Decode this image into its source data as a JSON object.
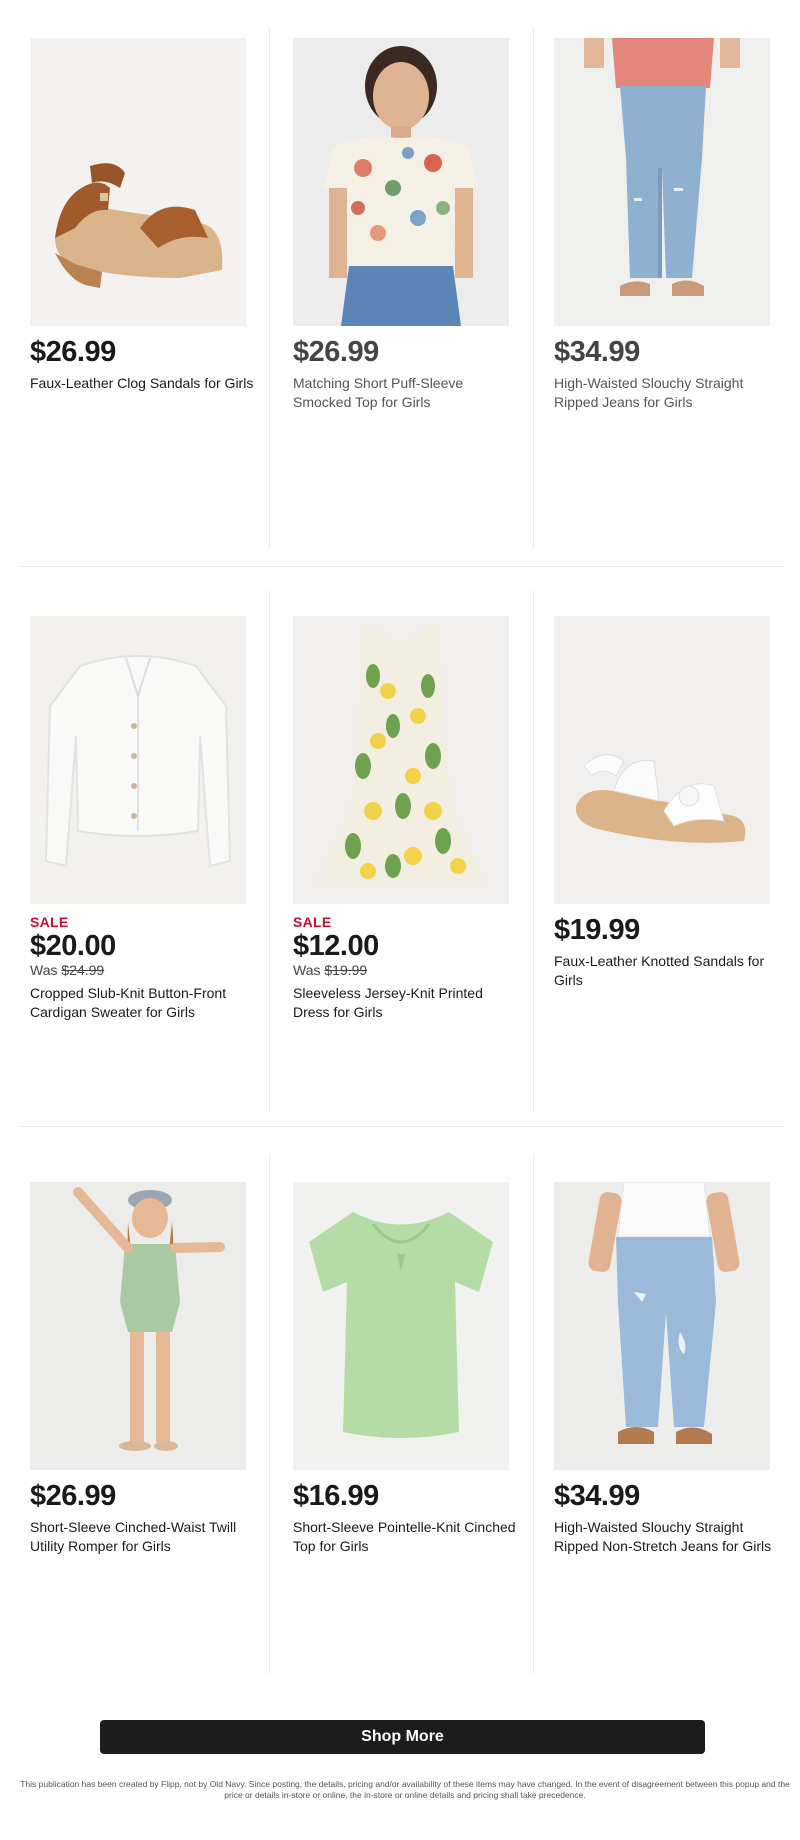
{
  "products": [
    {
      "price": "$26.99",
      "name": "Faux-Leather Clog Sandals for Girls",
      "sale": "",
      "was_prefix": "",
      "was_price": "",
      "image": "clog-sandal"
    },
    {
      "price": "$26.99",
      "name": "Matching Short Puff-Sleeve Smocked Top for Girls",
      "sale": "",
      "was_prefix": "",
      "was_price": "",
      "image": "floral-top"
    },
    {
      "price": "$34.99",
      "name": "High-Waisted Slouchy Straight Ripped Jeans for Girls",
      "sale": "",
      "was_prefix": "",
      "was_price": "",
      "image": "jeans"
    },
    {
      "price": "$20.00",
      "name": "Cropped Slub-Knit Button-Front Cardigan Sweater for Girls",
      "sale": "SALE",
      "was_prefix": "Was",
      "was_price": "$24.99",
      "image": "cardigan"
    },
    {
      "price": "$12.00",
      "name": "Sleeveless Jersey-Knit Printed Dress for Girls",
      "sale": "SALE",
      "was_prefix": "Was",
      "was_price": "$19.99",
      "image": "lemon-dress"
    },
    {
      "price": "$19.99",
      "name": "Faux-Leather Knotted Sandals for Girls",
      "sale": "",
      "was_prefix": "",
      "was_price": "",
      "image": "white-sandal"
    },
    {
      "price": "$26.99",
      "name": "Short-Sleeve Cinched-Waist Twill Utility Romper for Girls",
      "sale": "",
      "was_prefix": "",
      "was_price": "",
      "image": "romper"
    },
    {
      "price": "$16.99",
      "name": "Short-Sleeve Pointelle-Knit Cinched Top for Girls",
      "sale": "",
      "was_prefix": "",
      "was_price": "",
      "image": "green-top"
    },
    {
      "price": "$34.99",
      "name": "High-Waisted Slouchy Straight Ripped Non-Stretch Jeans for Girls",
      "sale": "",
      "was_prefix": "",
      "was_price": "",
      "image": "ripped-jeans"
    }
  ],
  "shop_more_label": "Shop More",
  "disclaimer": "This publication has been created by Flipp, not by Old Navy. Since posting, the details, pricing and/or availability of these items may have changed. In the event of disagreement between this popup and the price or details in-store or online, the in-store or online details and pricing shall take precedence.",
  "colors": {
    "sale": "#c8102e",
    "button_bg": "#1c1c1c",
    "price": "#1a1a1a"
  }
}
